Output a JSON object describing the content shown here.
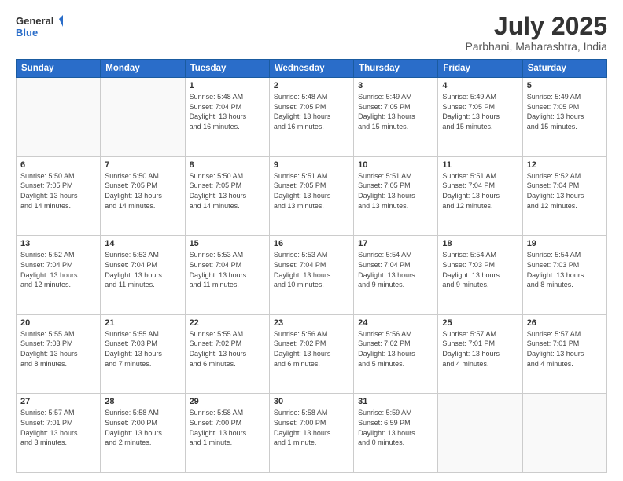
{
  "header": {
    "logo_line1": "General",
    "logo_line2": "Blue",
    "month": "July 2025",
    "location": "Parbhani, Maharashtra, India"
  },
  "weekdays": [
    "Sunday",
    "Monday",
    "Tuesday",
    "Wednesday",
    "Thursday",
    "Friday",
    "Saturday"
  ],
  "weeks": [
    [
      {
        "day": "",
        "info": ""
      },
      {
        "day": "",
        "info": ""
      },
      {
        "day": "1",
        "info": "Sunrise: 5:48 AM\nSunset: 7:04 PM\nDaylight: 13 hours\nand 16 minutes."
      },
      {
        "day": "2",
        "info": "Sunrise: 5:48 AM\nSunset: 7:05 PM\nDaylight: 13 hours\nand 16 minutes."
      },
      {
        "day": "3",
        "info": "Sunrise: 5:49 AM\nSunset: 7:05 PM\nDaylight: 13 hours\nand 15 minutes."
      },
      {
        "day": "4",
        "info": "Sunrise: 5:49 AM\nSunset: 7:05 PM\nDaylight: 13 hours\nand 15 minutes."
      },
      {
        "day": "5",
        "info": "Sunrise: 5:49 AM\nSunset: 7:05 PM\nDaylight: 13 hours\nand 15 minutes."
      }
    ],
    [
      {
        "day": "6",
        "info": "Sunrise: 5:50 AM\nSunset: 7:05 PM\nDaylight: 13 hours\nand 14 minutes."
      },
      {
        "day": "7",
        "info": "Sunrise: 5:50 AM\nSunset: 7:05 PM\nDaylight: 13 hours\nand 14 minutes."
      },
      {
        "day": "8",
        "info": "Sunrise: 5:50 AM\nSunset: 7:05 PM\nDaylight: 13 hours\nand 14 minutes."
      },
      {
        "day": "9",
        "info": "Sunrise: 5:51 AM\nSunset: 7:05 PM\nDaylight: 13 hours\nand 13 minutes."
      },
      {
        "day": "10",
        "info": "Sunrise: 5:51 AM\nSunset: 7:05 PM\nDaylight: 13 hours\nand 13 minutes."
      },
      {
        "day": "11",
        "info": "Sunrise: 5:51 AM\nSunset: 7:04 PM\nDaylight: 13 hours\nand 12 minutes."
      },
      {
        "day": "12",
        "info": "Sunrise: 5:52 AM\nSunset: 7:04 PM\nDaylight: 13 hours\nand 12 minutes."
      }
    ],
    [
      {
        "day": "13",
        "info": "Sunrise: 5:52 AM\nSunset: 7:04 PM\nDaylight: 13 hours\nand 12 minutes."
      },
      {
        "day": "14",
        "info": "Sunrise: 5:53 AM\nSunset: 7:04 PM\nDaylight: 13 hours\nand 11 minutes."
      },
      {
        "day": "15",
        "info": "Sunrise: 5:53 AM\nSunset: 7:04 PM\nDaylight: 13 hours\nand 11 minutes."
      },
      {
        "day": "16",
        "info": "Sunrise: 5:53 AM\nSunset: 7:04 PM\nDaylight: 13 hours\nand 10 minutes."
      },
      {
        "day": "17",
        "info": "Sunrise: 5:54 AM\nSunset: 7:04 PM\nDaylight: 13 hours\nand 9 minutes."
      },
      {
        "day": "18",
        "info": "Sunrise: 5:54 AM\nSunset: 7:03 PM\nDaylight: 13 hours\nand 9 minutes."
      },
      {
        "day": "19",
        "info": "Sunrise: 5:54 AM\nSunset: 7:03 PM\nDaylight: 13 hours\nand 8 minutes."
      }
    ],
    [
      {
        "day": "20",
        "info": "Sunrise: 5:55 AM\nSunset: 7:03 PM\nDaylight: 13 hours\nand 8 minutes."
      },
      {
        "day": "21",
        "info": "Sunrise: 5:55 AM\nSunset: 7:03 PM\nDaylight: 13 hours\nand 7 minutes."
      },
      {
        "day": "22",
        "info": "Sunrise: 5:55 AM\nSunset: 7:02 PM\nDaylight: 13 hours\nand 6 minutes."
      },
      {
        "day": "23",
        "info": "Sunrise: 5:56 AM\nSunset: 7:02 PM\nDaylight: 13 hours\nand 6 minutes."
      },
      {
        "day": "24",
        "info": "Sunrise: 5:56 AM\nSunset: 7:02 PM\nDaylight: 13 hours\nand 5 minutes."
      },
      {
        "day": "25",
        "info": "Sunrise: 5:57 AM\nSunset: 7:01 PM\nDaylight: 13 hours\nand 4 minutes."
      },
      {
        "day": "26",
        "info": "Sunrise: 5:57 AM\nSunset: 7:01 PM\nDaylight: 13 hours\nand 4 minutes."
      }
    ],
    [
      {
        "day": "27",
        "info": "Sunrise: 5:57 AM\nSunset: 7:01 PM\nDaylight: 13 hours\nand 3 minutes."
      },
      {
        "day": "28",
        "info": "Sunrise: 5:58 AM\nSunset: 7:00 PM\nDaylight: 13 hours\nand 2 minutes."
      },
      {
        "day": "29",
        "info": "Sunrise: 5:58 AM\nSunset: 7:00 PM\nDaylight: 13 hours\nand 1 minute."
      },
      {
        "day": "30",
        "info": "Sunrise: 5:58 AM\nSunset: 7:00 PM\nDaylight: 13 hours\nand 1 minute."
      },
      {
        "day": "31",
        "info": "Sunrise: 5:59 AM\nSunset: 6:59 PM\nDaylight: 13 hours\nand 0 minutes."
      },
      {
        "day": "",
        "info": ""
      },
      {
        "day": "",
        "info": ""
      }
    ]
  ]
}
